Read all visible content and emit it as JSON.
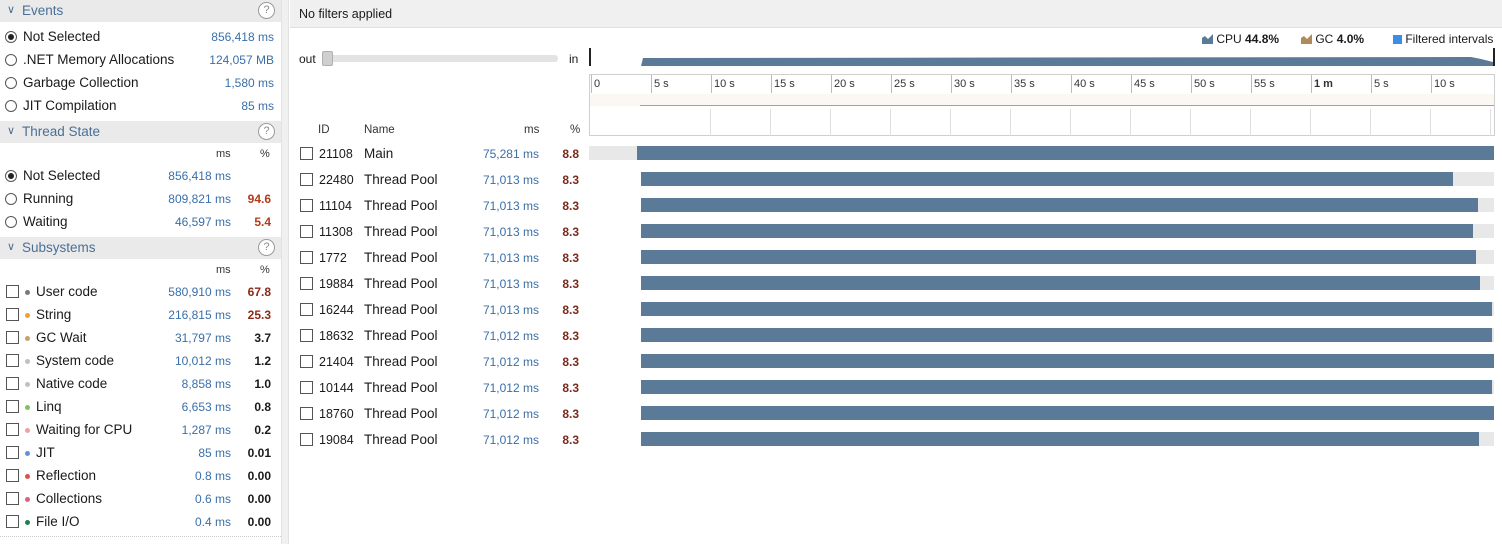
{
  "filters": {
    "events": {
      "title": "Events",
      "items": [
        {
          "label": "Not Selected",
          "ms": "856,418 ms",
          "selected": true
        },
        {
          "label": ".NET Memory Allocations",
          "ms": "124,057 MB",
          "selected": false
        },
        {
          "label": "Garbage Collection",
          "ms": "1,580 ms",
          "selected": false
        },
        {
          "label": "JIT Compilation",
          "ms": "85 ms",
          "selected": false
        }
      ]
    },
    "thread_state": {
      "title": "Thread State",
      "col_ms": "ms",
      "col_pct": "%",
      "items": [
        {
          "label": "Not Selected",
          "ms": "856,418 ms",
          "pct": "",
          "selected": true
        },
        {
          "label": "Running",
          "ms": "809,821 ms",
          "pct": "94.6",
          "selected": false
        },
        {
          "label": "Waiting",
          "ms": "46,597 ms",
          "pct": "5.4",
          "selected": false
        }
      ]
    },
    "subsystems": {
      "title": "Subsystems",
      "col_ms": "ms",
      "col_pct": "%",
      "items": [
        {
          "label": "User code",
          "ms": "580,910 ms",
          "pct": "67.8",
          "color": "#7a7a7a"
        },
        {
          "label": "String",
          "ms": "216,815 ms",
          "pct": "25.3",
          "color": "#f0a030"
        },
        {
          "label": "GC Wait",
          "ms": "31,797 ms",
          "pct": "3.7",
          "color": "#c8a070"
        },
        {
          "label": "System code",
          "ms": "10,012 ms",
          "pct": "1.2",
          "color": "#c0c0c0"
        },
        {
          "label": "Native code",
          "ms": "8,858 ms",
          "pct": "1.0",
          "color": "#c0c0c0"
        },
        {
          "label": "Linq",
          "ms": "6,653 ms",
          "pct": "0.8",
          "color": "#80c060"
        },
        {
          "label": "Waiting for CPU",
          "ms": "1,287 ms",
          "pct": "0.2",
          "color": "#f0a0a0"
        },
        {
          "label": "JIT",
          "ms": "85 ms",
          "pct": "0.01",
          "color": "#6090e0"
        },
        {
          "label": "Reflection",
          "ms": "0.8 ms",
          "pct": "0.00",
          "color": "#e05050"
        },
        {
          "label": "Collections",
          "ms": "0.6 ms",
          "pct": "0.00",
          "color": "#e06080"
        },
        {
          "label": "File I/O",
          "ms": "0.4 ms",
          "pct": "0.00",
          "color": "#208050"
        }
      ]
    },
    "help_glyph": "?"
  },
  "timeline": {
    "filter_status": "No filters applied",
    "zoom_out": "out",
    "zoom_in": "in",
    "legend": {
      "cpu_label": "CPU",
      "cpu_value": "44.8%",
      "gc_label": "GC",
      "gc_value": "4.0%",
      "filtered_label": "Filtered intervals",
      "cpu_color": "#5a7a98",
      "gc_color": "#b08a5a",
      "filtered_color": "#3a8ee6"
    },
    "ticks": [
      "0",
      "5 s",
      "10 s",
      "15 s",
      "20 s",
      "25 s",
      "30 s",
      "35 s",
      "40 s",
      "45 s",
      "50 s",
      "55 s",
      "1 m",
      "5 s",
      "10 s"
    ],
    "columns": {
      "id": "ID",
      "name": "Name",
      "ms": "ms",
      "pct": "%"
    },
    "threads": [
      {
        "id": "21108",
        "name": "Main",
        "ms": "75,281 ms",
        "pct": "8.8",
        "start": 0.053,
        "end": 1.0
      },
      {
        "id": "22480",
        "name": "Thread Pool",
        "ms": "71,013 ms",
        "pct": "8.3",
        "start": 0.058,
        "end": 0.955
      },
      {
        "id": "11104",
        "name": "Thread Pool",
        "ms": "71,013 ms",
        "pct": "8.3",
        "start": 0.058,
        "end": 0.982
      },
      {
        "id": "11308",
        "name": "Thread Pool",
        "ms": "71,013 ms",
        "pct": "8.3",
        "start": 0.058,
        "end": 0.977
      },
      {
        "id": "1772",
        "name": "Thread Pool",
        "ms": "71,013 ms",
        "pct": "8.3",
        "start": 0.058,
        "end": 0.98
      },
      {
        "id": "19884",
        "name": "Thread Pool",
        "ms": "71,013 ms",
        "pct": "8.3",
        "start": 0.058,
        "end": 0.985
      },
      {
        "id": "16244",
        "name": "Thread Pool",
        "ms": "71,013 ms",
        "pct": "8.3",
        "start": 0.058,
        "end": 0.998
      },
      {
        "id": "18632",
        "name": "Thread Pool",
        "ms": "71,012 ms",
        "pct": "8.3",
        "start": 0.058,
        "end": 0.998
      },
      {
        "id": "21404",
        "name": "Thread Pool",
        "ms": "71,012 ms",
        "pct": "8.3",
        "start": 0.058,
        "end": 1.0
      },
      {
        "id": "10144",
        "name": "Thread Pool",
        "ms": "71,012 ms",
        "pct": "8.3",
        "start": 0.058,
        "end": 0.998
      },
      {
        "id": "18760",
        "name": "Thread Pool",
        "ms": "71,012 ms",
        "pct": "8.3",
        "start": 0.058,
        "end": 1.0
      },
      {
        "id": "19084",
        "name": "Thread Pool",
        "ms": "71,012 ms",
        "pct": "8.3",
        "start": 0.058,
        "end": 0.983
      }
    ]
  }
}
